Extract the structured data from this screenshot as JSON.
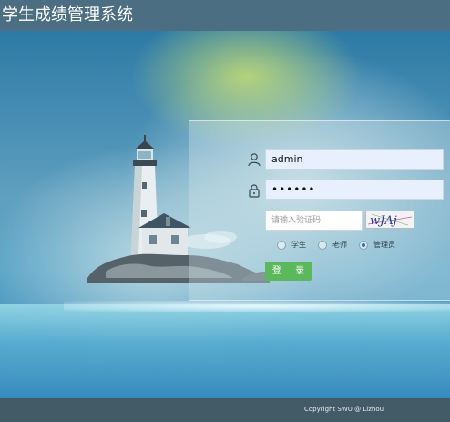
{
  "header": {
    "title": "学生成绩管理系统"
  },
  "login": {
    "username": "admin",
    "password": "••••••",
    "captcha_placeholder": "请输入验证码",
    "captcha_text": "wJAj",
    "roles": [
      {
        "label": "学生",
        "selected": false
      },
      {
        "label": "老师",
        "selected": false
      },
      {
        "label": "管理员",
        "selected": true
      }
    ],
    "login_label": "登 录"
  },
  "footer": {
    "copyright": "Copyright   SWU @ Lizhou"
  },
  "icons": {
    "user": "user-icon",
    "lock": "lock-icon"
  },
  "colors": {
    "header": "#4b6e82",
    "footer": "#435b66",
    "login_button": "#5cb85c",
    "input_fill": "#e8f0fe"
  }
}
